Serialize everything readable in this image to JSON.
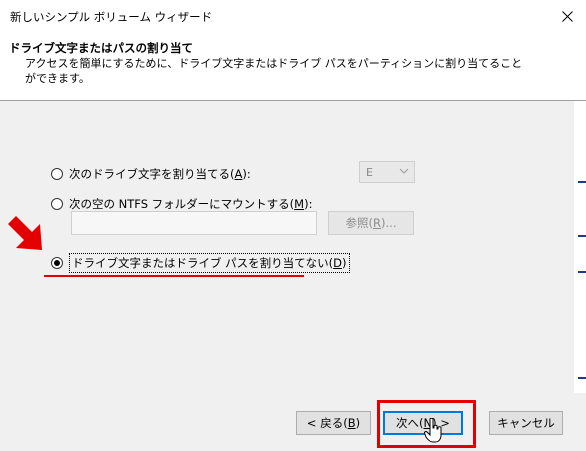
{
  "window": {
    "title": "新しいシンプル ボリューム ウィザード",
    "close_icon": "close-icon"
  },
  "header": {
    "title": "ドライブ文字またはパスの割り当て",
    "description": "アクセスを簡単にするために、ドライブ文字またはドライブ パスをパーティションに割り当てることができます。"
  },
  "options": [
    {
      "label_pre": "次のドライブ文字を割り当てる(",
      "mnemonic": "A",
      "label_post": "):",
      "checked": false
    },
    {
      "label_pre": "次の空の NTFS フォルダーにマウントする(",
      "mnemonic": "M",
      "label_post": "):",
      "checked": false
    },
    {
      "label_pre": "ドライブ文字またはドライブ パスを割り当てない(",
      "mnemonic": "D",
      "label_post": ")",
      "checked": true
    }
  ],
  "drive_letter": {
    "value": "E",
    "enabled": false
  },
  "path_input": {
    "value": "",
    "enabled": false
  },
  "browse_button": {
    "label_pre": "参照(",
    "mnemonic": "R",
    "label_post": ")..."
  },
  "footer": {
    "back": {
      "label_pre": "< 戻る(",
      "mnemonic": "B",
      "label_post": ")"
    },
    "next": {
      "label_pre": "次へ(",
      "mnemonic": "N",
      "label_post": ") >"
    },
    "cancel": {
      "label": "キャンセル"
    }
  },
  "annotation_color": "#e30000",
  "accent_color": "#0078d7"
}
